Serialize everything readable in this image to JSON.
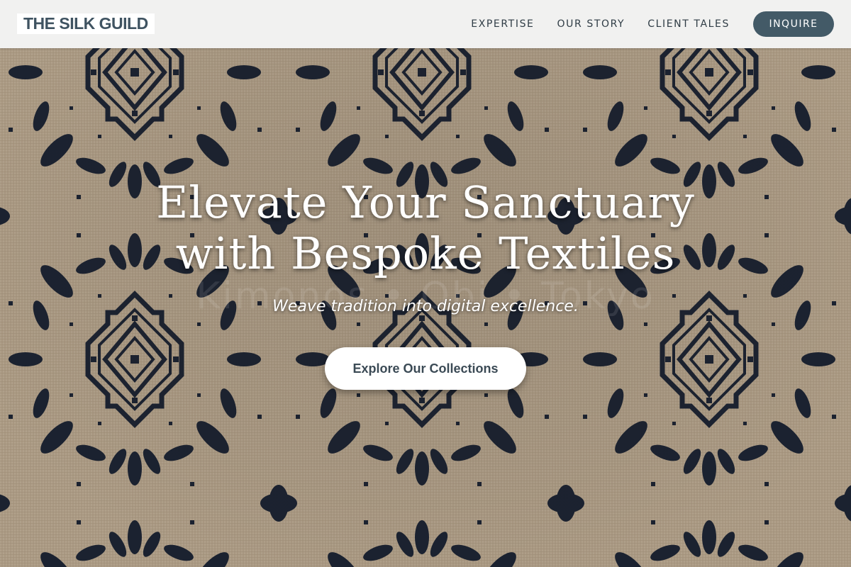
{
  "brand": {
    "logo_text": "THE SILK GUILD"
  },
  "nav": {
    "items": [
      {
        "label": "EXPERTISE"
      },
      {
        "label": "OUR STORY"
      },
      {
        "label": "CLIENT TALES"
      }
    ],
    "inquire_label": "INQUIRE"
  },
  "hero": {
    "title_line1": "Elevate Your Sanctuary",
    "title_line2": "with Bespoke Textiles",
    "ghost_text": "Kimonos • Obi • Tokyo",
    "subtitle": "Weave tradition into digital excellence.",
    "cta_label": "Explore Our Collections"
  },
  "colors": {
    "header_bg": "#f1f1f0",
    "brand_text": "#3f5361",
    "accent_button": "#435a67",
    "textile_base": "#a99882",
    "textile_ink": "#1b2230"
  },
  "icons": {
    "background": "woven-textile-pattern"
  }
}
